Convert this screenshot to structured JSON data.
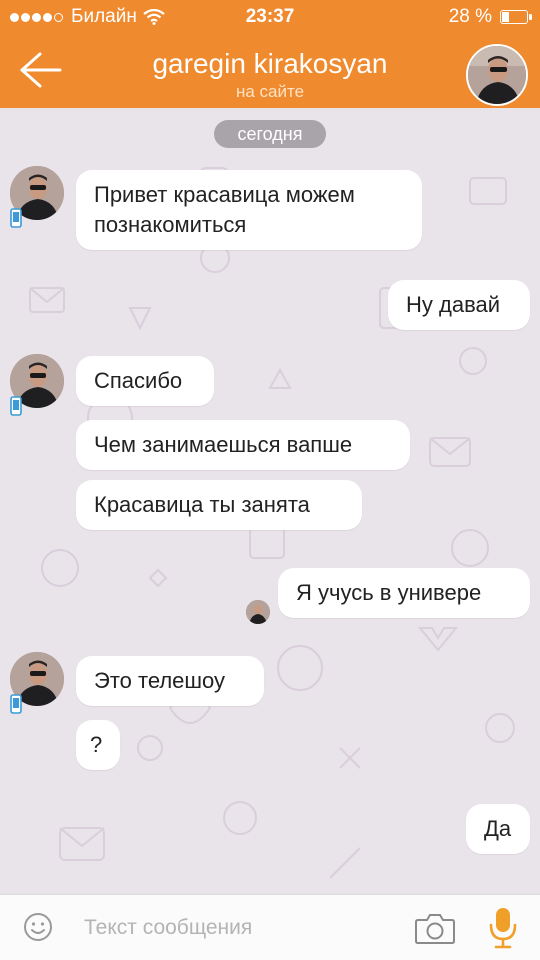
{
  "status_bar": {
    "carrier": "Билайн",
    "time": "23:37",
    "battery": "28 %",
    "battery_level": 0.28
  },
  "header": {
    "contact_name": "garegin kirakosyan",
    "status": "на сайте"
  },
  "chat": {
    "date_label": "сегодня",
    "messages": [
      {
        "side": "left",
        "text": "Привет красавица можем познакомиться"
      },
      {
        "side": "right",
        "text": "Ну давай"
      },
      {
        "side": "left",
        "text": "Спасибо"
      },
      {
        "side": "left",
        "text": "Чем занимаешься вапше"
      },
      {
        "side": "left",
        "text": "Красавица ты занята"
      },
      {
        "side": "right",
        "text": "Я учусь в универе"
      },
      {
        "side": "left",
        "text": "Это телешоу"
      },
      {
        "side": "left",
        "text": "?"
      },
      {
        "side": "right",
        "text": "Да"
      }
    ]
  },
  "input": {
    "placeholder": "Текст сообщения"
  },
  "icons": {
    "back": "arrow-left-icon",
    "emoji": "smile-icon",
    "camera": "camera-icon",
    "mic": "microphone-icon",
    "device": "mobile-phone-icon"
  },
  "colors": {
    "header": "#f08a2e",
    "background": "#e9e3ea",
    "bubble": "#ffffff",
    "mic": "#f0a028"
  }
}
